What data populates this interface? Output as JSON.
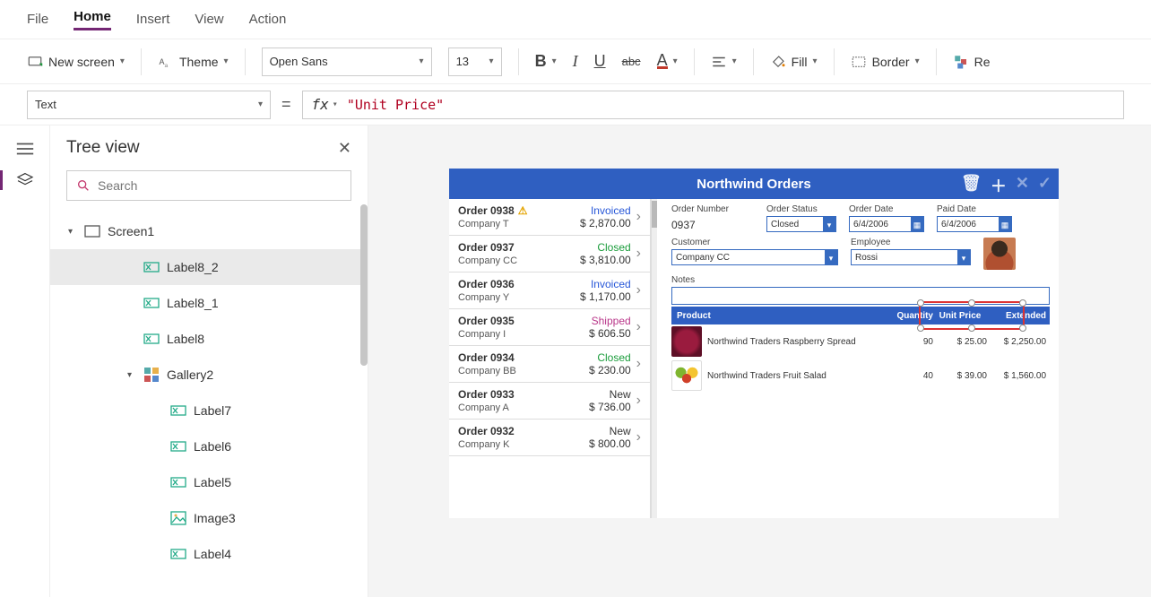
{
  "menu": {
    "items": [
      "File",
      "Home",
      "Insert",
      "View",
      "Action"
    ],
    "active": "Home"
  },
  "ribbon": {
    "new_screen": "New screen",
    "theme": "Theme",
    "font_name": "Open Sans",
    "font_size": "13",
    "fill": "Fill",
    "border": "Border",
    "re": "Re"
  },
  "formula": {
    "property": "Text",
    "fx": "fx",
    "value": "\"Unit Price\""
  },
  "tree": {
    "title": "Tree view",
    "search_placeholder": "Search",
    "screen": "Screen1",
    "items": [
      "Label8_2",
      "Label8_1",
      "Label8"
    ],
    "gallery": "Gallery2",
    "gallery_items": [
      "Label7",
      "Label6",
      "Label5",
      "Image3",
      "Label4"
    ],
    "selected": "Label8_2"
  },
  "app": {
    "title": "Northwind Orders",
    "orders": [
      {
        "name": "Order 0938",
        "company": "Company T",
        "status": "Invoiced",
        "status_cls": "invoiced",
        "amount": "$ 2,870.00",
        "warn": true
      },
      {
        "name": "Order 0937",
        "company": "Company CC",
        "status": "Closed",
        "status_cls": "closed",
        "amount": "$ 3,810.00"
      },
      {
        "name": "Order 0936",
        "company": "Company Y",
        "status": "Invoiced",
        "status_cls": "invoiced",
        "amount": "$ 1,170.00"
      },
      {
        "name": "Order 0935",
        "company": "Company I",
        "status": "Shipped",
        "status_cls": "shipped",
        "amount": "$ 606.50"
      },
      {
        "name": "Order 0934",
        "company": "Company BB",
        "status": "Closed",
        "status_cls": "closed",
        "amount": "$ 230.00"
      },
      {
        "name": "Order 0933",
        "company": "Company A",
        "status": "New",
        "status_cls": "new",
        "amount": "$ 736.00"
      },
      {
        "name": "Order 0932",
        "company": "Company K",
        "status": "New",
        "status_cls": "new",
        "amount": "$ 800.00"
      }
    ],
    "detail": {
      "labels": {
        "order_number": "Order Number",
        "order_status": "Order Status",
        "order_date": "Order Date",
        "paid_date": "Paid Date",
        "customer": "Customer",
        "employee": "Employee",
        "notes": "Notes"
      },
      "order_number": "0937",
      "order_status": "Closed",
      "order_date": "6/4/2006",
      "paid_date": "6/4/2006",
      "customer": "Company CC",
      "employee": "Rossi",
      "cols": {
        "product": "Product",
        "qty": "Quantity",
        "price": "Unit Price",
        "ext": "Extended"
      },
      "lines": [
        {
          "product": "Northwind Traders Raspberry Spread",
          "qty": "90",
          "price": "$ 25.00",
          "ext": "$ 2,250.00",
          "img": "berry"
        },
        {
          "product": "Northwind Traders Fruit Salad",
          "qty": "40",
          "price": "$ 39.00",
          "ext": "$ 1,560.00",
          "img": "salad"
        }
      ]
    }
  }
}
